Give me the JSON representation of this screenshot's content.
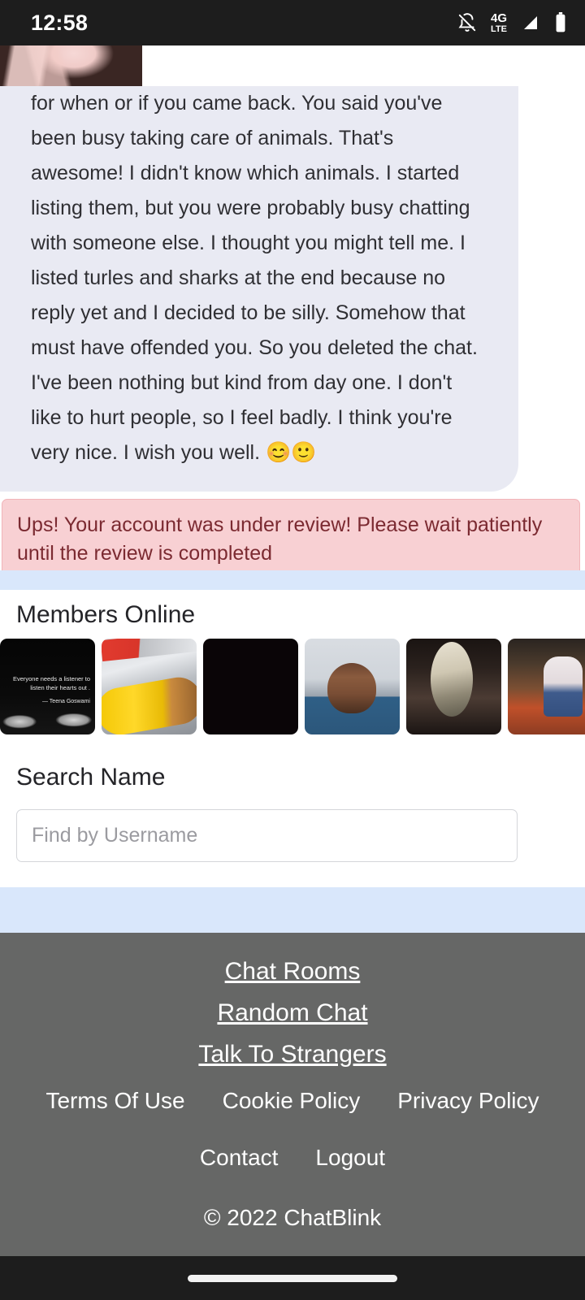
{
  "status_bar": {
    "time": "12:58",
    "icons": [
      "bell-muted-icon",
      "4g-lte-icon",
      "signal-icon",
      "battery-icon"
    ],
    "network_label_main": "4G",
    "network_label_sub": "LTE"
  },
  "chat": {
    "message_text": "for when or if you came back. You said you've been busy taking care of animals. That's awesome! I didn't know which animals. I started listing them, but you were probably busy chatting with someone else. I thought you might tell me. I listed turles and sharks at the end because no reply yet and I decided to be silly. Somehow that must have offended you. So you deleted the chat. I've been nothing but kind from day one. I don't like to hurt people, so I feel badly. I think you're very nice. I wish you well. 😊🙂"
  },
  "alert": {
    "text": "Ups! Your account was under review! Please wait patiently until the review is completed",
    "background_color": "#f8d0d3",
    "border_color": "#f1b4b9",
    "text_color": "#7b2a31"
  },
  "members": {
    "title": "Members Online",
    "thumbnails": [
      {
        "name": "member-thumb-quote",
        "caption": "Everyone needs a listener to listen their hearts out .",
        "attribution": "— Teena Goswami"
      },
      {
        "name": "member-thumb-corn",
        "caption": "",
        "attribution": ""
      },
      {
        "name": "member-thumb-dark",
        "caption": "",
        "attribution": ""
      },
      {
        "name": "member-thumb-smiling-man",
        "caption": "",
        "attribution": ""
      },
      {
        "name": "member-thumb-fish",
        "caption": "",
        "attribution": ""
      },
      {
        "name": "member-thumb-seated-man",
        "caption": "",
        "attribution": ""
      }
    ]
  },
  "search": {
    "title": "Search Name",
    "placeholder": "Find by Username",
    "value": ""
  },
  "footer": {
    "primary_links": [
      "Chat Rooms",
      "Random Chat",
      "Talk To Strangers"
    ],
    "secondary_links": [
      "Terms Of Use",
      "Cookie Policy",
      "Privacy Policy"
    ],
    "tertiary_links": [
      "Contact",
      "Logout"
    ],
    "copyright": "© 2022 ChatBlink",
    "background_color": "#666766"
  },
  "theme": {
    "divider_blue": "#d9e7fb",
    "bubble_background": "#e9eaf3",
    "status_bar_background": "#1d1d1d"
  }
}
